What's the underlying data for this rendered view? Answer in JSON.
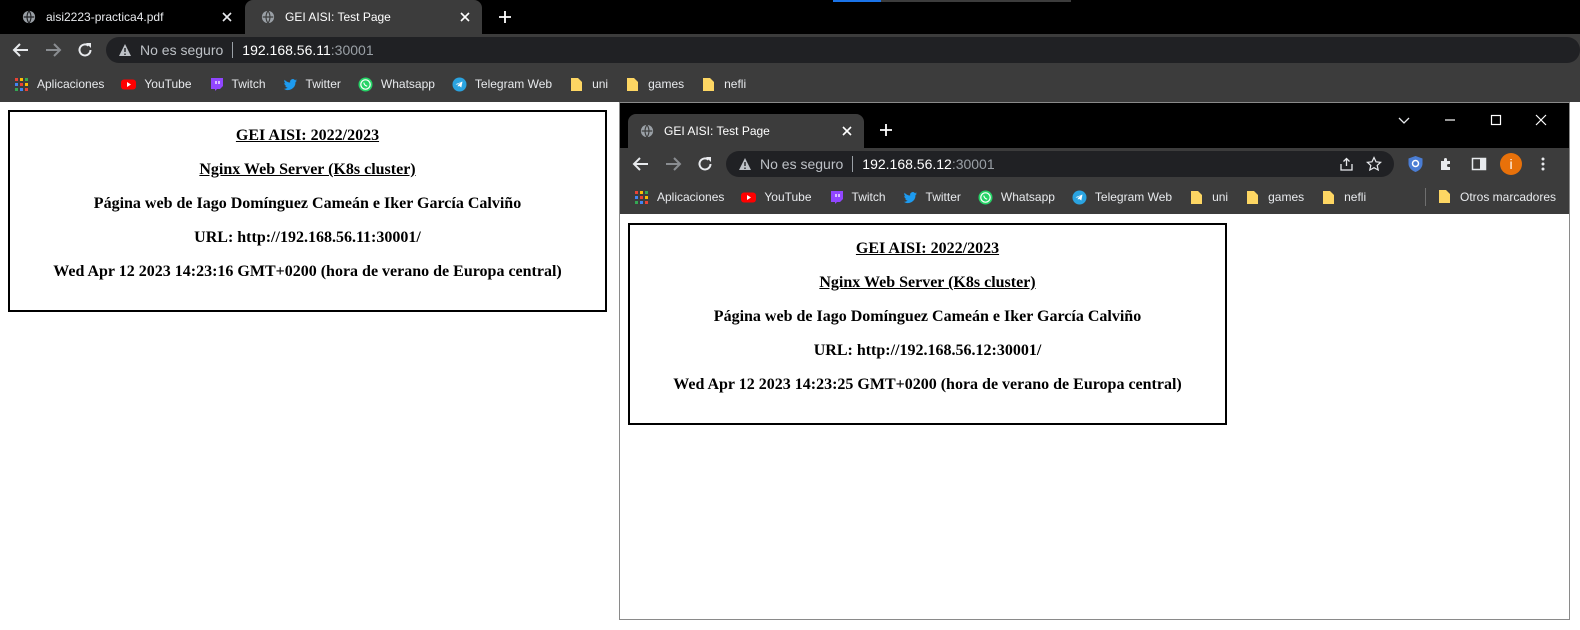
{
  "browser": {
    "tabs": [
      {
        "title": "aisi2223-practica4.pdf",
        "active": false
      },
      {
        "title": "GEI AISI: Test Page",
        "active": true
      }
    ],
    "address": {
      "security_label": "No es seguro",
      "host": "192.168.56.11",
      "port": ":30001"
    },
    "bookmarks": [
      "Aplicaciones",
      "YouTube",
      "Twitch",
      "Twitter",
      "Whatsapp",
      "Telegram Web",
      "uni",
      "games",
      "nefli"
    ]
  },
  "page": {
    "heading": "GEI AISI: 2022/2023",
    "subheading": "Nginx Web Server (K8s cluster)",
    "authors": "Página web de Iago Domínguez Cameán e Iker García Calviño",
    "url_line": "URL: http://192.168.56.11:30001/",
    "date_line": "Wed Apr 12 2023 14:23:16 GMT+0200 (hora de verano de Europa central)"
  },
  "window2": {
    "tab_title": "GEI AISI: Test Page",
    "address": {
      "security_label": "No es seguro",
      "host": "192.168.56.12",
      "port": ":30001"
    },
    "bookmarks": [
      "Aplicaciones",
      "YouTube",
      "Twitch",
      "Twitter",
      "Whatsapp",
      "Telegram Web",
      "uni",
      "games",
      "nefli"
    ],
    "other_bookmarks": "Otros marcadores",
    "profile_initial": "i",
    "page": {
      "heading": "GEI AISI: 2022/2023",
      "subheading": "Nginx Web Server (K8s cluster)",
      "authors": "Página web de Iago Domínguez Cameán e Iker García Calviño",
      "url_line": "URL: http://192.168.56.12:30001/",
      "date_line": "Wed Apr 12 2023 14:23:25 GMT+0200 (hora de verano de Europa central)"
    }
  },
  "icons": {
    "youtube_color": "#ff0000",
    "twitch_color": "#9146ff",
    "twitter_color": "#1d9bf0",
    "whatsapp_color": "#25d366",
    "telegram_color": "#2aa3e0",
    "folder_color": "#fdd663",
    "profile_color": "#e8710a"
  }
}
